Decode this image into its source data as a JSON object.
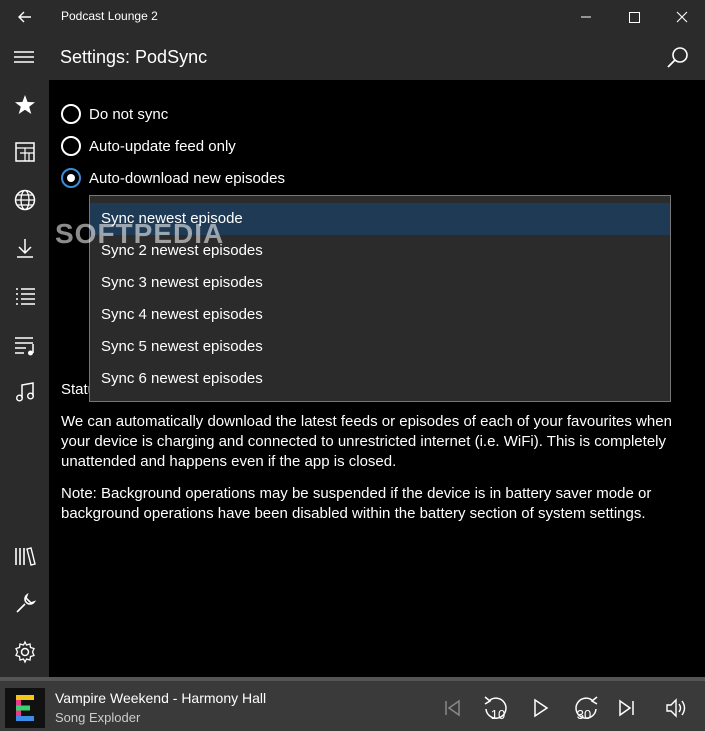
{
  "window": {
    "title": "Podcast Lounge 2"
  },
  "header": {
    "title": "Settings: PodSync"
  },
  "sync_options": [
    {
      "label": "Do not sync",
      "checked": false
    },
    {
      "label": "Auto-update feed only",
      "checked": false
    },
    {
      "label": "Auto-download new episodes",
      "checked": true
    }
  ],
  "dropdown": {
    "options": [
      "Sync newest episode",
      "Sync 2 newest episodes",
      "Sync 3 newest episodes",
      "Sync 4 newest episodes",
      "Sync 5 newest episodes",
      "Sync 6 newest episodes"
    ],
    "selected": "Sync newest episode"
  },
  "status_label": "Statu",
  "description": "We can automatically download the latest feeds or episodes of each of your favourites when your device is charging and connected to unrestricted internet (i.e. WiFi). This is completely unattended and happens even if the app is closed.",
  "note": "Note: Background operations may be suspended if the device is in battery saver mode or background operations have been disabled within the battery section of system settings.",
  "watermark": "SOFTPEDIA",
  "player": {
    "title": "Vampire Weekend - Harmony Hall",
    "subtitle": "Song Exploder",
    "skip_back_seconds": "10",
    "skip_forward_seconds": "30"
  },
  "colors": {
    "accent": "#3b8bd9",
    "chrome": "#2b2b2b",
    "player": "#3a3a3a",
    "selected": "#1f3a54"
  }
}
